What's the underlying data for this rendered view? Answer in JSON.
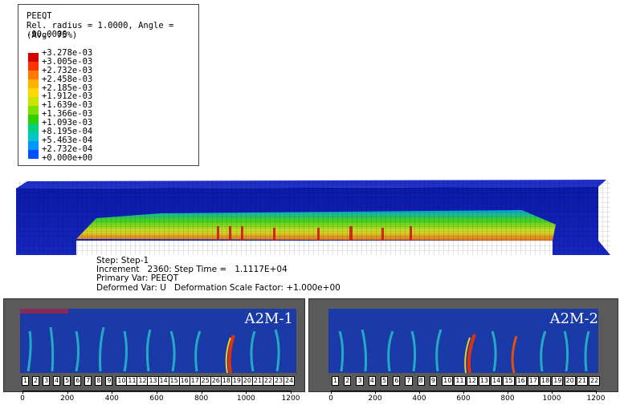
{
  "legend": {
    "title": "PEEQT",
    "subtitle": "Rel. radius = 1.0000, Angle = -90.0000",
    "avg": "(Avg: 75%)",
    "values": [
      "+3.278e-03",
      "+3.005e-03",
      "+2.732e-03",
      "+2.458e-03",
      "+2.185e-03",
      "+1.912e-03",
      "+1.639e-03",
      "+1.366e-03",
      "+1.093e-03",
      "+8.195e-04",
      "+5.463e-04",
      "+2.732e-04",
      "+0.000e+00"
    ],
    "colors": [
      "#d40000",
      "#ff3300",
      "#ff7a00",
      "#ffb300",
      "#ffd800",
      "#c8e600",
      "#7fe000",
      "#2ed000",
      "#00d27a",
      "#00c8c8",
      "#0096ff",
      "#0050ff",
      "#0000d8"
    ]
  },
  "step_info": {
    "line1": "Step: Step-1",
    "line2": "Increment   2360: Step Time =   1.1117E+04",
    "line3": "Primary Var: PEEQT",
    "line4": "Deformed Var: U   Deformation Scale Factor: +1.000e+00"
  },
  "photos": [
    {
      "label": "A2M-1",
      "marks": [
        "1",
        "2",
        "3",
        "4",
        "5",
        "6",
        "7",
        "8",
        "9",
        "10",
        "11",
        "12",
        "13",
        "14",
        "15",
        "16",
        "17",
        "25",
        "26",
        "18",
        "19",
        "20",
        "21",
        "22",
        "23",
        "24"
      ]
    },
    {
      "label": "A2M-2",
      "marks": [
        "1",
        "2",
        "3",
        "4",
        "5",
        "6",
        "7",
        "8",
        "9",
        "10",
        "11",
        "12",
        "13",
        "14",
        "15",
        "16",
        "17",
        "18",
        "19",
        "20",
        "21",
        "22"
      ]
    }
  ],
  "axis_ticks": [
    "0",
    "200",
    "400",
    "600",
    "800",
    "1000",
    "1200"
  ]
}
